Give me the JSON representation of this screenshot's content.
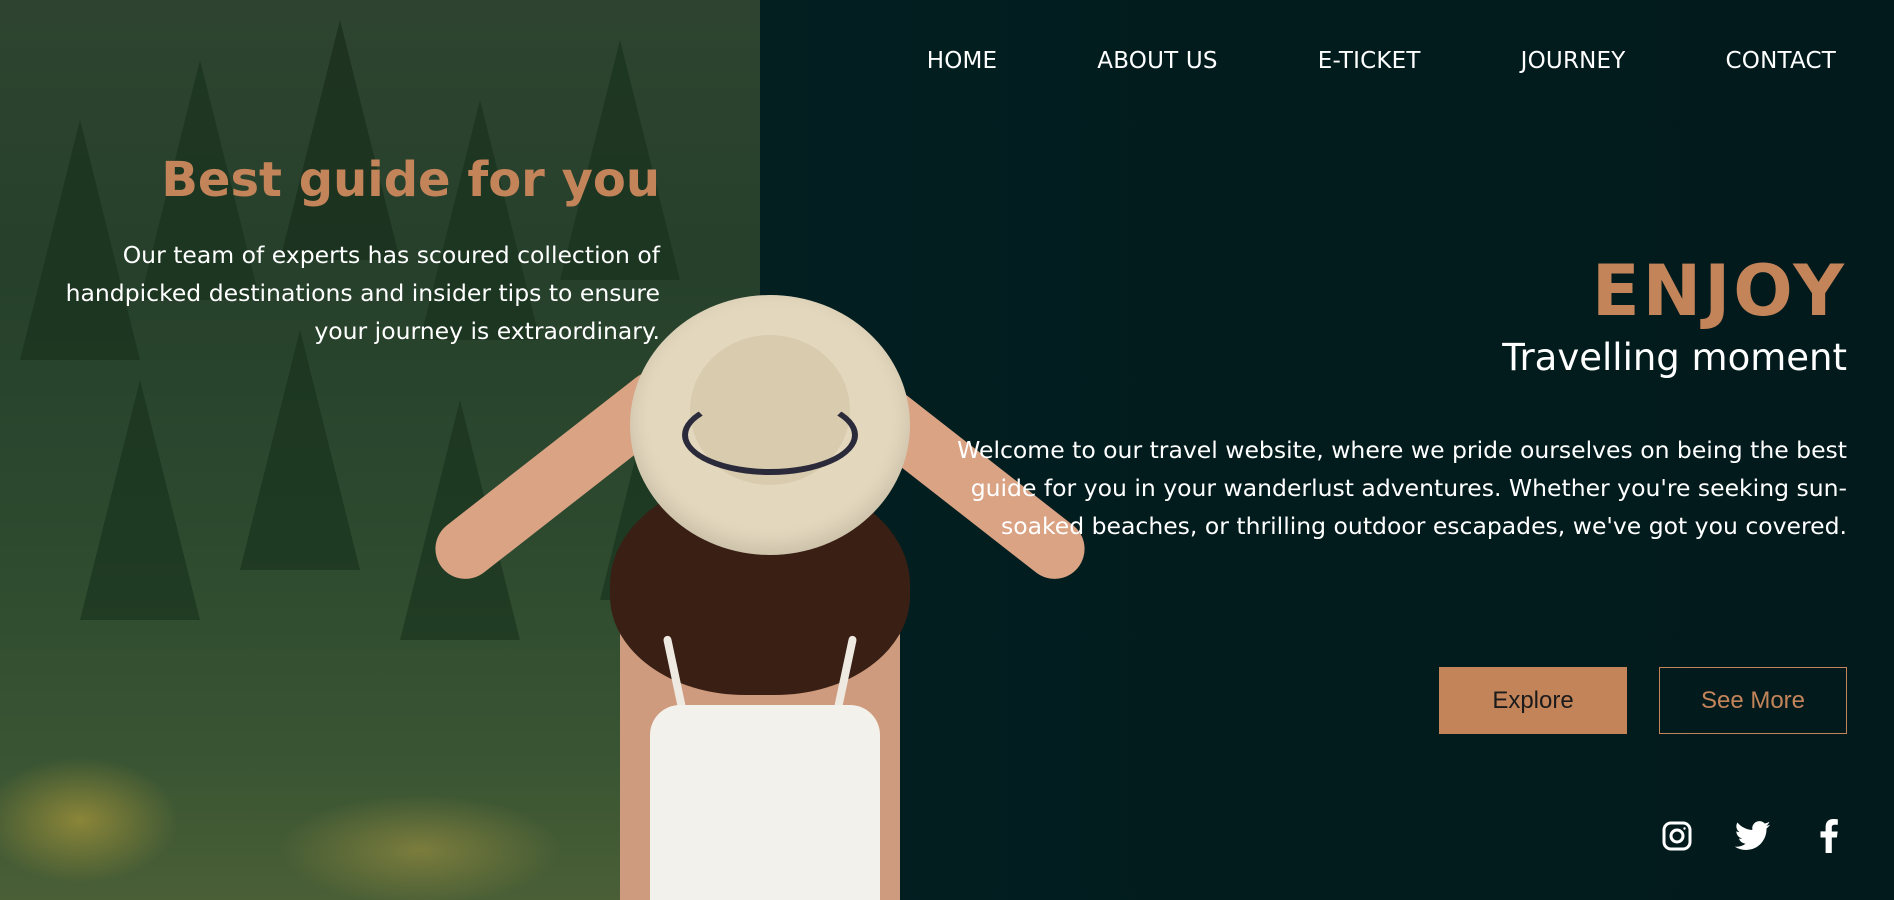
{
  "nav": {
    "items": [
      {
        "label": "HOME"
      },
      {
        "label": "ABOUT US"
      },
      {
        "label": "E-TICKET"
      },
      {
        "label": "JOURNEY"
      },
      {
        "label": "CONTACT"
      }
    ]
  },
  "intro": {
    "title": "Best guide for you",
    "text": "Our team of experts has scoured collection of handpicked destinations and insider tips to ensure your journey is extraordinary."
  },
  "hero": {
    "headline": "ENJOY",
    "subtitle": "Travelling moment",
    "text": "Welcome to our travel website, where we pride ourselves on being the best guide for you in your wanderlust adventures. Whether you're seeking sun-soaked beaches, or thrilling outdoor escapades, we've got you covered."
  },
  "buttons": {
    "explore": "Explore",
    "see_more": "See More"
  },
  "social": [
    "instagram-icon",
    "twitter-icon",
    "facebook-icon"
  ],
  "colors": {
    "accent": "#c3845a",
    "background": "#021c1e",
    "text": "#ffffff"
  }
}
